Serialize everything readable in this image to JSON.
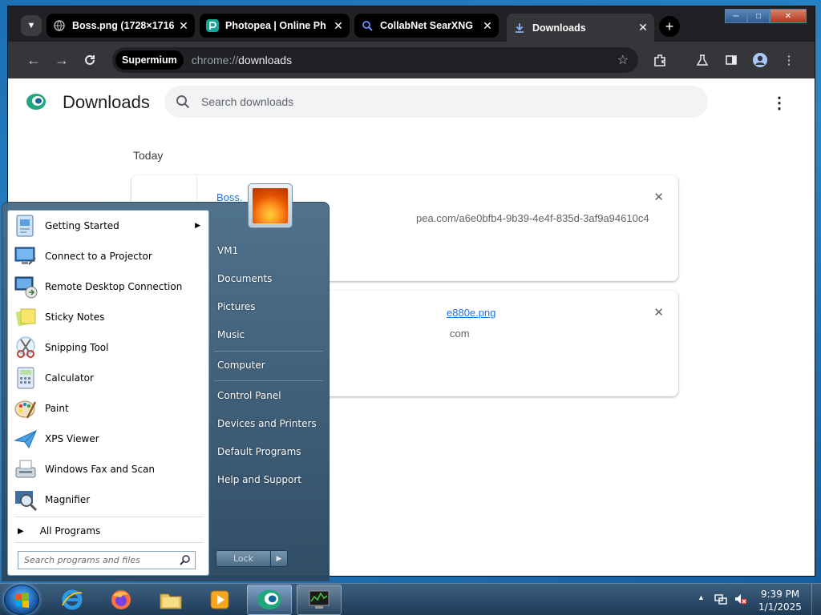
{
  "browser": {
    "tabs": [
      {
        "title": "Boss.png (1728×1716",
        "favicon": "globe-icon",
        "active": false
      },
      {
        "title": "Photopea | Online Ph",
        "favicon": "photopea-icon",
        "active": false
      },
      {
        "title": "CollabNet SearXNG",
        "favicon": "searxng-icon",
        "active": false
      },
      {
        "title": "Downloads",
        "favicon": "download-icon",
        "active": true
      }
    ],
    "tab_close_glyph": "✕",
    "new_tab_glyph": "+",
    "omnibox": {
      "chip": "Supermium",
      "scheme": "chrome://",
      "host": "downloads"
    }
  },
  "downloads_page": {
    "title": "Downloads",
    "search_placeholder": "Search downloads",
    "date_group": "Today",
    "items": [
      {
        "filename": "Boss.",
        "source": "pea.com/a6e0bfb4-9b39-4e4f-835d-3af9a94610c4"
      },
      {
        "filename": "e880e.png",
        "source": "com"
      }
    ],
    "remove_glyph": "✕"
  },
  "start_menu": {
    "programs": [
      {
        "label": "Getting Started",
        "icon": "getting-started-icon",
        "has_submenu": true
      },
      {
        "label": "Connect to a Projector",
        "icon": "projector-icon",
        "has_submenu": false
      },
      {
        "label": "Remote Desktop Connection",
        "icon": "remote-desktop-icon",
        "has_submenu": false
      },
      {
        "label": "Sticky Notes",
        "icon": "sticky-notes-icon",
        "has_submenu": false
      },
      {
        "label": "Snipping Tool",
        "icon": "snipping-tool-icon",
        "has_submenu": false
      },
      {
        "label": "Calculator",
        "icon": "calculator-icon",
        "has_submenu": false
      },
      {
        "label": "Paint",
        "icon": "paint-icon",
        "has_submenu": false
      },
      {
        "label": "XPS Viewer",
        "icon": "xps-viewer-icon",
        "has_submenu": false
      },
      {
        "label": "Windows Fax and Scan",
        "icon": "fax-scan-icon",
        "has_submenu": false
      },
      {
        "label": "Magnifier",
        "icon": "magnifier-icon",
        "has_submenu": false
      }
    ],
    "all_programs": "All Programs",
    "search_placeholder": "Search programs and files",
    "places": [
      "VM1",
      "Documents",
      "Pictures",
      "Music",
      "Computer",
      "Control Panel",
      "Devices and Printers",
      "Default Programs",
      "Help and Support"
    ],
    "lock_label": "Lock"
  },
  "taskbar": {
    "time": "9:39 PM",
    "date": "1/1/2025",
    "pinned": [
      "start-orb",
      "internet-explorer-icon",
      "firefox-icon",
      "file-explorer-icon",
      "media-player-icon",
      "supermium-icon",
      "task-manager-icon"
    ]
  }
}
